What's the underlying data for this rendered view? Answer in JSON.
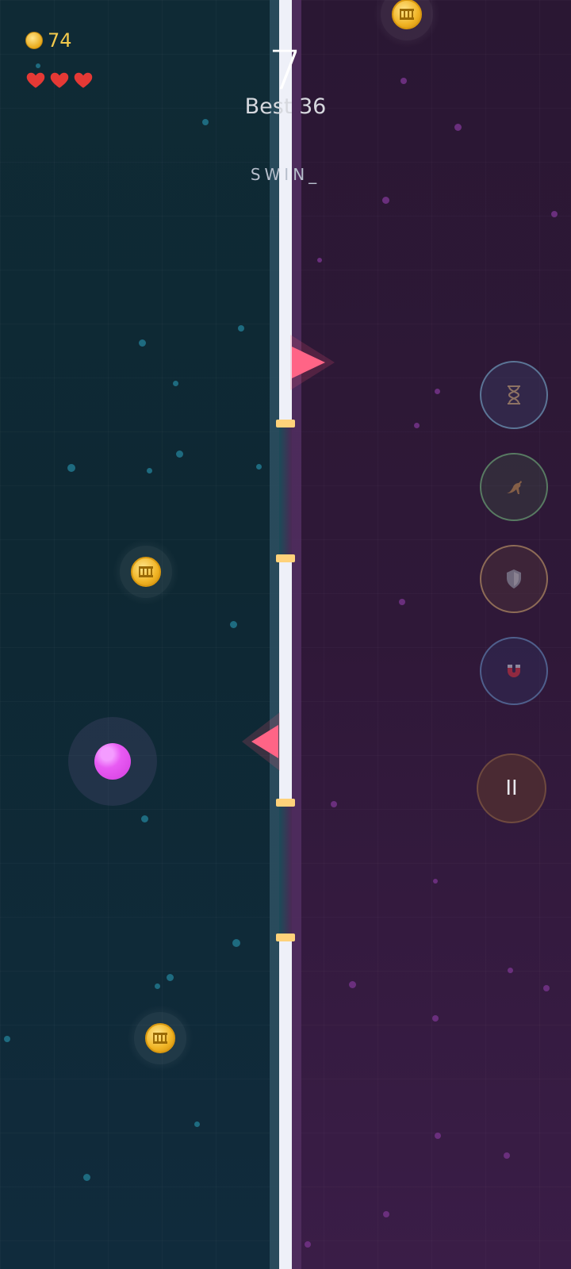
{
  "hud": {
    "coins": "74",
    "lives": 3,
    "score": "7",
    "best": "Best 36",
    "typing_text": "SWIN_"
  },
  "powerups": [
    {
      "name": "slow-time",
      "icon": "hourglass-icon"
    },
    {
      "name": "jump",
      "icon": "kangaroo-icon"
    },
    {
      "name": "shield",
      "icon": "shield-icon"
    },
    {
      "name": "magnet",
      "icon": "magnet-icon"
    }
  ],
  "pause_label": "II",
  "colors": {
    "left_bg": "#0f2a35",
    "right_bg": "#2f1838",
    "wall": "#eef0f8",
    "cap": "#ffd27a",
    "spike": "#ff5a7a",
    "player": "#e85bf3",
    "coin": "#f0b323"
  }
}
